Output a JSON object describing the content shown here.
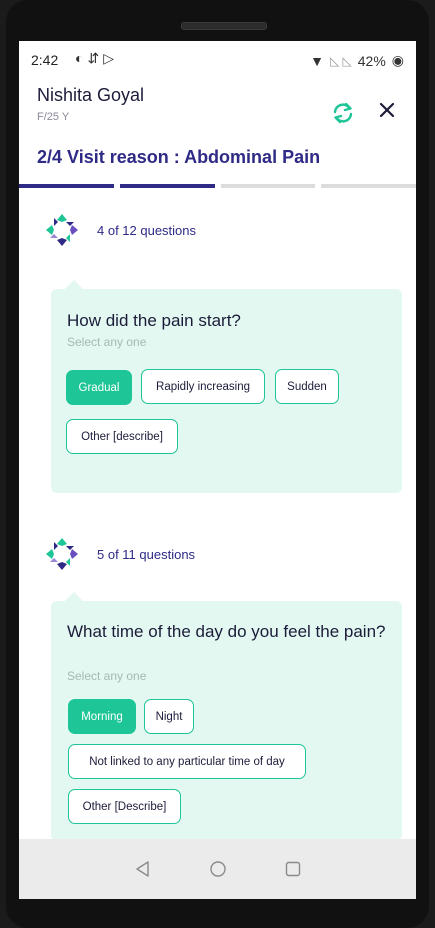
{
  "status_bar": {
    "time": "2:42",
    "battery": "42%"
  },
  "header": {
    "patient_name": "Nishita Goyal",
    "patient_meta": "F/25 Y",
    "visit_reason": "2/4 Visit reason : Abdominal Pain",
    "progress": {
      "current_step": 2,
      "total_steps": 4,
      "active_color": "#2e2a86",
      "inactive_color": "#dcdcdc"
    }
  },
  "questions": [
    {
      "count_label": "4 of 12 questions",
      "question": "How did the pain start?",
      "hint": "Select any one",
      "options": [
        {
          "label": "Gradual",
          "selected": true
        },
        {
          "label": "Rapidly increasing",
          "selected": false
        },
        {
          "label": "Sudden",
          "selected": false
        },
        {
          "label": "Other [describe]",
          "selected": false
        }
      ]
    },
    {
      "count_label": "5 of 11 questions",
      "question": "What time of the day do you feel the pain?",
      "hint": "Select any one",
      "options": [
        {
          "label": "Morning",
          "selected": true
        },
        {
          "label": "Night",
          "selected": false
        },
        {
          "label": "Not linked to any particular time of day",
          "selected": false
        },
        {
          "label": "Other [Describe]",
          "selected": false
        }
      ]
    }
  ],
  "colors": {
    "accent": "#1ec596",
    "card_bg": "#e2f8f1",
    "primary_text": "#2e2a86"
  },
  "icons": {
    "refresh": "refresh-icon",
    "close": "close-icon",
    "back": "nav-back-icon",
    "home": "nav-home-icon",
    "recents": "nav-recents-icon"
  }
}
